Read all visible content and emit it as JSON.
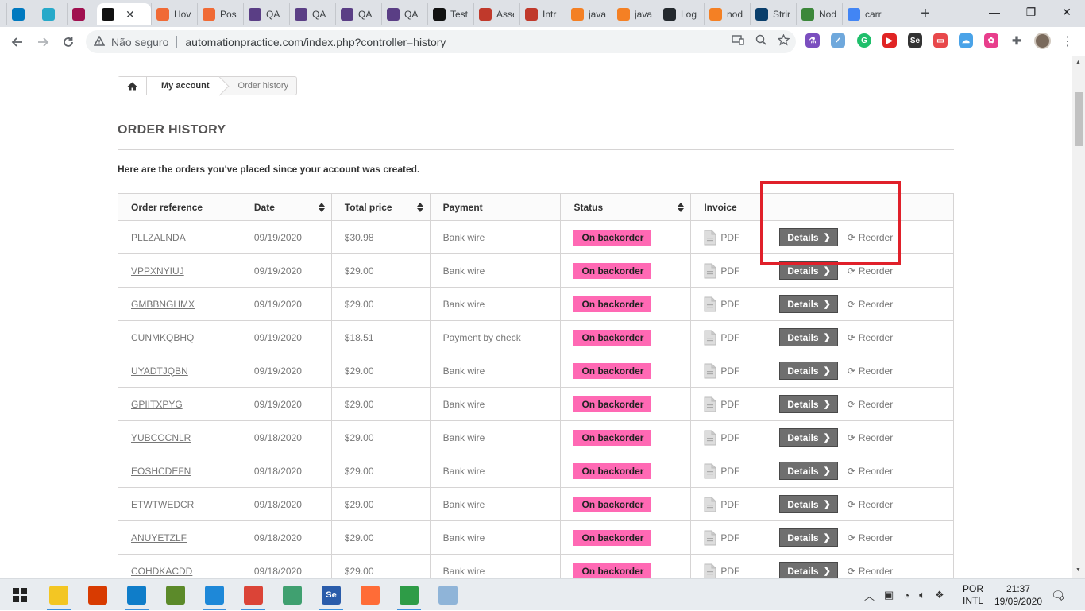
{
  "browser": {
    "tabs": [
      {
        "label": "",
        "icon": "trello-icon",
        "color": "#0079bf"
      },
      {
        "label": "",
        "icon": "udemy-u-icon",
        "color": "#27a9c9"
      },
      {
        "label": "",
        "icon": "udemy-icon",
        "color": "#a0104f"
      },
      {
        "label": "",
        "icon": "store-icon",
        "color": "#111111",
        "active": true
      },
      {
        "label": "Hov",
        "icon": "hover-icon",
        "color": "#f06a35"
      },
      {
        "label": "Pos",
        "icon": "hover-icon",
        "color": "#f06a35"
      },
      {
        "label": "QA",
        "icon": "qa-icon",
        "color": "#5a3e85"
      },
      {
        "label": "QA",
        "icon": "qa-icon",
        "color": "#5a3e85"
      },
      {
        "label": "QA",
        "icon": "qa-icon",
        "color": "#5a3e85"
      },
      {
        "label": "QA",
        "icon": "qa-icon",
        "color": "#5a3e85"
      },
      {
        "label": "Test",
        "icon": "medium-icon",
        "color": "#111111"
      },
      {
        "label": "Asse",
        "icon": "cypress-icon",
        "color": "#c0392b"
      },
      {
        "label": "Intr",
        "icon": "cypress-icon",
        "color": "#c0392b"
      },
      {
        "label": "java",
        "icon": "stackoverflow-icon",
        "color": "#f48024"
      },
      {
        "label": "java",
        "icon": "stackoverflow-icon",
        "color": "#f48024"
      },
      {
        "label": "Log",
        "icon": "github-icon",
        "color": "#24292e"
      },
      {
        "label": "nod",
        "icon": "stackoverflow-icon",
        "color": "#f48024"
      },
      {
        "label": "Strir",
        "icon": "strapi-icon",
        "color": "#0a3e6b"
      },
      {
        "label": "Nod",
        "icon": "node-icon",
        "color": "#3c873a"
      },
      {
        "label": "carr",
        "icon": "google-icon",
        "color": "#4285f4"
      }
    ],
    "active_tab_close": "✕",
    "new_tab": "+",
    "window_controls": {
      "minimize": "—",
      "maximize": "❐",
      "close": "✕"
    },
    "security_label": "Não seguro",
    "url": "automationpractice.com/index.php?controller=history"
  },
  "breadcrumb": {
    "home": "⌂",
    "account": "My account",
    "current": "Order history"
  },
  "page": {
    "title": "ORDER HISTORY",
    "info": "Here are the orders you've placed since your account was created."
  },
  "table": {
    "headers": {
      "reference": "Order reference",
      "date": "Date",
      "total": "Total price",
      "payment": "Payment",
      "status": "Status",
      "invoice": "Invoice",
      "actions": ""
    },
    "details_label": "Details",
    "reorder_label": "Reorder",
    "pdf_label": "PDF",
    "rows": [
      {
        "reference": "PLLZALNDA",
        "date": "09/19/2020",
        "total": "$30.98",
        "payment": "Bank wire",
        "status": "On backorder"
      },
      {
        "reference": "VPPXNYIUJ",
        "date": "09/19/2020",
        "total": "$29.00",
        "payment": "Bank wire",
        "status": "On backorder"
      },
      {
        "reference": "GMBBNGHMX",
        "date": "09/19/2020",
        "total": "$29.00",
        "payment": "Bank wire",
        "status": "On backorder"
      },
      {
        "reference": "CUNMKQBHQ",
        "date": "09/19/2020",
        "total": "$18.51",
        "payment": "Payment by check",
        "status": "On backorder"
      },
      {
        "reference": "UYADTJQBN",
        "date": "09/19/2020",
        "total": "$29.00",
        "payment": "Bank wire",
        "status": "On backorder"
      },
      {
        "reference": "GPIITXPYG",
        "date": "09/19/2020",
        "total": "$29.00",
        "payment": "Bank wire",
        "status": "On backorder"
      },
      {
        "reference": "YUBCOCNLR",
        "date": "09/18/2020",
        "total": "$29.00",
        "payment": "Bank wire",
        "status": "On backorder"
      },
      {
        "reference": "EOSHCDEFN",
        "date": "09/18/2020",
        "total": "$29.00",
        "payment": "Bank wire",
        "status": "On backorder"
      },
      {
        "reference": "ETWTWEDCR",
        "date": "09/18/2020",
        "total": "$29.00",
        "payment": "Bank wire",
        "status": "On backorder"
      },
      {
        "reference": "ANUYETZLF",
        "date": "09/18/2020",
        "total": "$29.00",
        "payment": "Bank wire",
        "status": "On backorder"
      },
      {
        "reference": "COHDKACDD",
        "date": "09/18/2020",
        "total": "$29.00",
        "payment": "Bank wire",
        "status": "On backorder"
      }
    ]
  },
  "colors": {
    "status_badge": "#ff69b4",
    "highlight_box": "#e0202a",
    "details_button": "#6f6f6f"
  },
  "taskbar": {
    "apps": [
      {
        "name": "file-explorer-icon",
        "color": "#f3c623"
      },
      {
        "name": "office-icon",
        "color": "#d83b01"
      },
      {
        "name": "edge-icon",
        "color": "#0f7dc9"
      },
      {
        "name": "archive-tool-icon",
        "color": "#5c8a2a"
      },
      {
        "name": "vscode-icon",
        "color": "#1e88d8"
      },
      {
        "name": "chrome-icon",
        "color": "#db4437"
      },
      {
        "name": "atom-icon",
        "color": "#40a070"
      },
      {
        "name": "selenium-ide-icon",
        "color": "#2a5caa",
        "text": "Se"
      },
      {
        "name": "postman-icon",
        "color": "#ff6c37"
      },
      {
        "name": "calc-sheet-icon",
        "color": "#2e9c47"
      },
      {
        "name": "notes-app-icon",
        "color": "#8fb4d8"
      }
    ],
    "lang_top": "POR",
    "lang_bottom": "INTL",
    "time": "21:37",
    "date": "19/09/2020",
    "notifications": "2"
  }
}
